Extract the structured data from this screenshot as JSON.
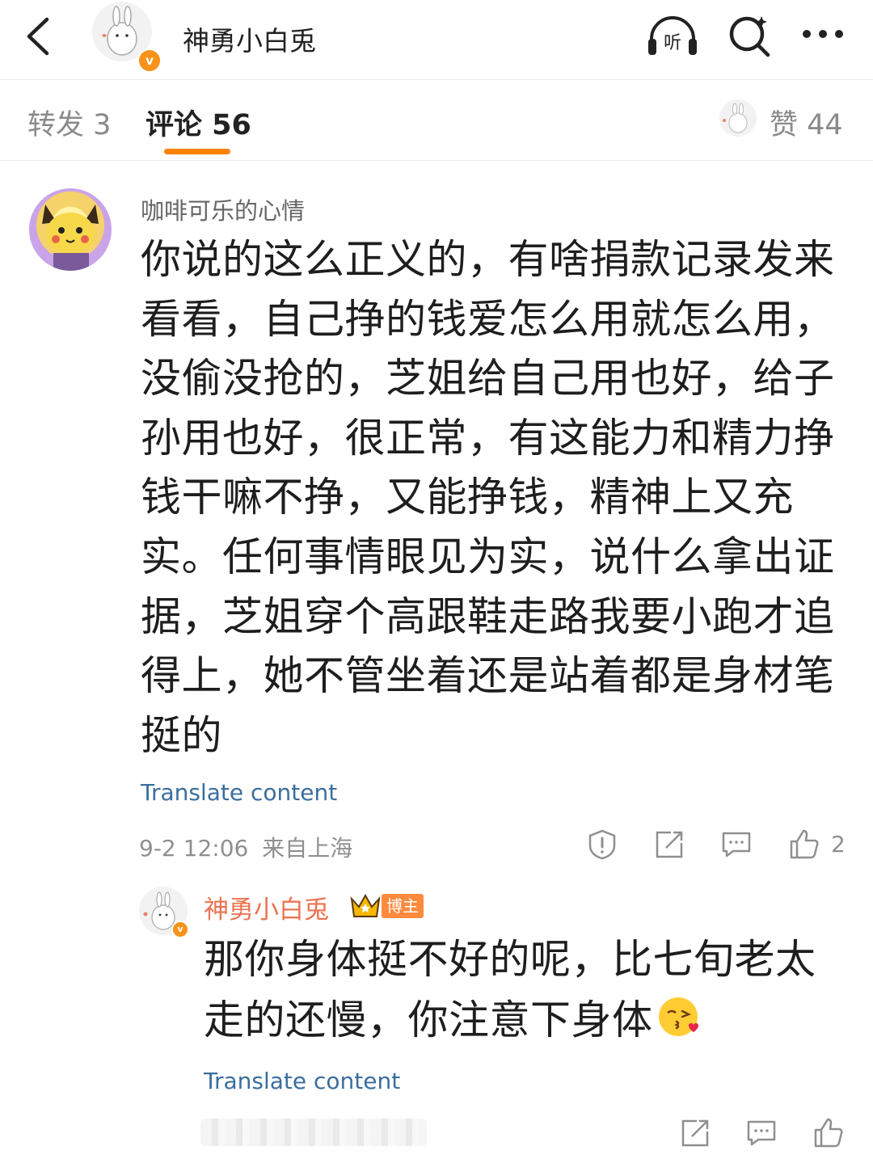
{
  "header": {
    "title": "神勇小白兎"
  },
  "tabs": {
    "repost_label": "转发 3",
    "comments_label": "评论 56",
    "likes_label": "赞 44"
  },
  "comment": {
    "author": "咖啡可乐的心情",
    "text": "你说的这么正义的，有啥捐款记录发来看看，自己挣的钱爱怎么用就怎么用，没偷没抢的，芝姐给自己用也好，给子孙用也好，很正常，有这能力和精力挣钱干嘛不挣，又能挣钱，精神上又充实。任何事情眼见为实，说什么拿出证据，芝姐穿个高跟鞋走路我要小跑才追得上，她不管坐着还是站着都是身材笔挺的",
    "translate": "Translate content",
    "timestamp": "9-2 12:06",
    "location": "来自上海",
    "like_count": "2"
  },
  "reply": {
    "author": "神勇小白兎",
    "badge": "博主",
    "text": "那你身体挺不好的呢，比七旬老太走的还慢，你注意下身体",
    "translate": "Translate content"
  },
  "icons": {
    "back": "back-chevron-icon",
    "listen": "listen-headphones-icon",
    "search": "search-icon",
    "more": "more-icon",
    "report": "report-icon",
    "share": "share-icon",
    "reply": "comment-icon",
    "like": "like-thumb-icon"
  },
  "colors": {
    "accent": "#ff8200",
    "author_reply": "#eb7350",
    "link": "#3a6e9e",
    "muted": "#8f8f8f"
  }
}
